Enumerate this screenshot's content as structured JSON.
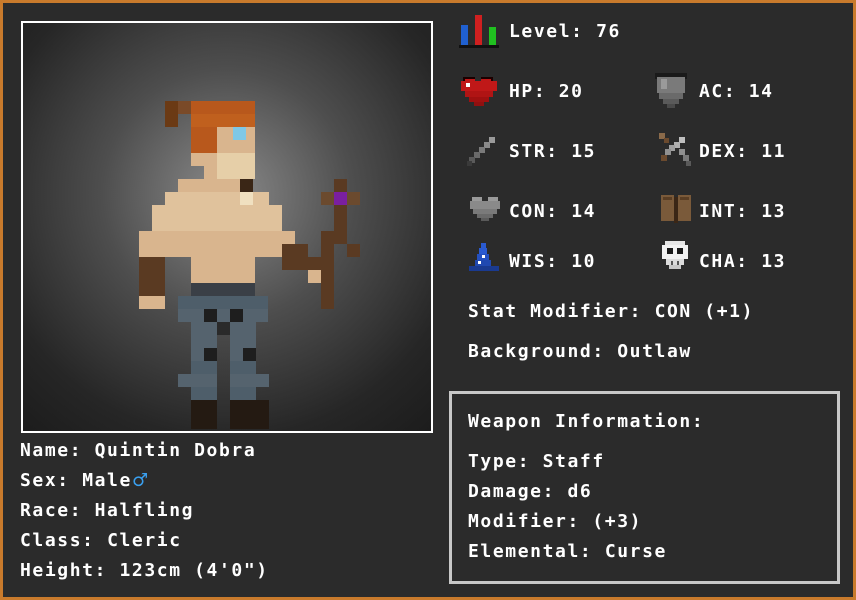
{
  "character": {
    "level_label": "Level:",
    "level_value": "76",
    "name_label": "Name:",
    "name_value": "Quintin Dobra",
    "sex_label": "Sex:",
    "sex_value": "Male",
    "sex_symbol": "♂",
    "race_label": "Race:",
    "race_value": "Halfling",
    "class_label": "Class:",
    "class_value": "Cleric",
    "height_label": "Height:",
    "height_value": "123cm (4'0\")",
    "portrait_icon": "halfling-cleric-portrait"
  },
  "stats": [
    {
      "icon": "heart-icon",
      "label": "HP:",
      "value": "20"
    },
    {
      "icon": "shield-icon",
      "label": "AC:",
      "value": "14"
    },
    {
      "icon": "sword-icon",
      "label": "STR:",
      "value": "15"
    },
    {
      "icon": "crossed-swords-icon",
      "label": "DEX:",
      "value": "11"
    },
    {
      "icon": "grey-heart-icon",
      "label": "CON:",
      "value": "14"
    },
    {
      "icon": "book-icon",
      "label": "INT:",
      "value": "13"
    },
    {
      "icon": "wizard-hat-icon",
      "label": "WIS:",
      "value": "10"
    },
    {
      "icon": "skull-icon",
      "label": "CHA:",
      "value": "13"
    }
  ],
  "stat_modifier": {
    "label": "Stat Modifier:",
    "value": "CON (+1)"
  },
  "background": {
    "label": "Background:",
    "value": "Outlaw"
  },
  "weapon": {
    "title": "Weapon Information:",
    "type_label": "Type:",
    "type_value": "Staff",
    "damage_label": "Damage:",
    "damage_value": "d6",
    "modifier_label": "Modifier:",
    "modifier_value": "(+3)",
    "elemental_label": "Elemental:",
    "elemental_value": "Curse"
  },
  "colors": {
    "border": "#c87a2c",
    "panel": "#2b2b2b",
    "text": "#ffffff",
    "male_symbol": "#3aa0f0"
  }
}
